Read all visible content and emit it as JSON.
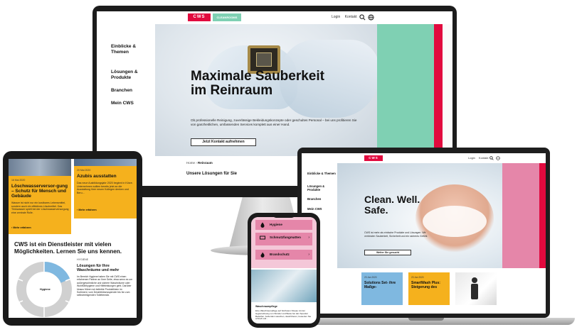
{
  "desktop": {
    "logo": "CWS",
    "badge": "CLEANROOMS",
    "top_links": [
      "Login",
      "Kontakt"
    ],
    "nav": [
      "Einblicke & Themen",
      "Lösungen & Produkte",
      "Branchen",
      "Mein CWS"
    ],
    "hero_title": "Maximale Sauberkeit im Reinraum",
    "hero_text": "Ob professionelle Reinigung, zuverlässige Bekleidungskonzepte oder geschultes Personal – bei uns profitieren Sie von ganzheitlichen, umfassenden Services komplett aus einer Hand.",
    "hero_button": "Jetzt Kontakt aufnehmen",
    "breadcrumb_home": "Home",
    "breadcrumb_current": "Reinraum",
    "solutions_heading": "Unsere Lösungen für Sie",
    "colors": {
      "brand_red": "#e10a3e",
      "mint": "#7fd0b3"
    }
  },
  "laptop": {
    "logo": "CWS",
    "top_links": [
      "Login",
      "Kontakt"
    ],
    "nav": [
      "Einblicke & Themen",
      "Lösungen & Produkte",
      "Branchen",
      "Mein CWS"
    ],
    "hero_title": "Clean. Well. Safe.",
    "hero_text": "CWS ist mehr als einfache Produkte und Lösungen. Wir verbinden Sauberkeit, Sicherheit und ein sicheres Gefühl.",
    "hero_button": "Weiter Sie gesucht",
    "cards": [
      {
        "date": "23 Jan 2020",
        "title": "Solutions Set- ihre Maßge-"
      },
      {
        "date": "23 Jan 2020",
        "title": "SmartWash Plus: Steigerung des"
      }
    ],
    "colors": {
      "pink": "#e586a9",
      "brand_red": "#e10a3e"
    }
  },
  "tablet": {
    "card1": {
      "date": "16 Mai 2020",
      "title": "Löschwasserversor-gung – Schutz für Mensch und Gebäude",
      "text": "Wasser ist nicht nur ein kostbares Lebensmittel, sondern auch ein effektives Löschmittel. Das Trinkwasser spielt bei der Löschwasserversorgung eine zentrale Rolle.",
      "more": "Mehr erfahren"
    },
    "card2": {
      "date": "20 Mai 2020",
      "title": "Azubis ausstatten",
      "text": "Das neue Ausbildungsjahr 2020 beginnt in Kürze. Unternehmen sollten bereits jetzt an die Ausstattung ihrer neuen Kollegen denken und Beru...",
      "more": "Mehr erfahren"
    },
    "headline": "CWS ist ein Dienstleister mit vielen Möglichkeiten. Lernen Sie uns kennen.",
    "circle_label": "Hygiene",
    "section_label": "HYGIENE",
    "section_title": "Lösungen für Ihre Waschräume und mehr",
    "section_text": "Im Bereich Hygiene haben Sie mit CWS einen erfahrenen Partner an Ihrer Seite, etwa wenn es um außergewöhnliche und sichere Waschräume oder Wohlfühlhygiene und Hilfeleistungen geht. Darüber hinaus führen wir beliebte Produktlinien im Sortiment, vom Desinfektionsspender bis hin zum selbstreinigenden Toilettensitz."
  },
  "phone": {
    "items": [
      {
        "label": "Hygiene"
      },
      {
        "label": "Schmutzfangmatten"
      },
      {
        "label": "Brandschutz"
      }
    ],
    "label": "Waschraumpflege",
    "text": "Eine Waschraumpflege auf höchstem Niveau mit der Hygienelösung von Wunder und Beste bei den Spender Bedarfen. Außerdem waschen, desinfizieren, bewerten Sie schnell und..."
  }
}
